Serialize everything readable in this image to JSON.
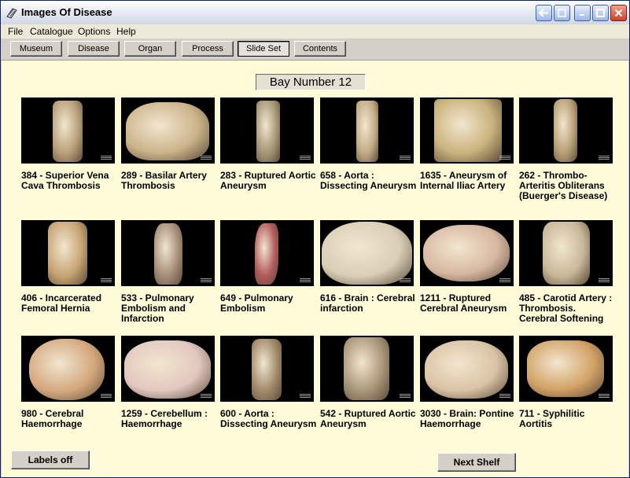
{
  "window": {
    "title": "Images Of Disease"
  },
  "menu": [
    "File",
    "Catalogue",
    "Options",
    "Help"
  ],
  "nav": {
    "buttons": [
      "Museum",
      "Disease",
      "Organ",
      "Process",
      "Slide Set",
      "Contents"
    ],
    "active": "Slide Set"
  },
  "bay_label": "Bay Number 12",
  "items": [
    {
      "caption": "384 - Superior Vena Cava Thrombosis",
      "specimen_color": "#b9a07a"
    },
    {
      "caption": "289 - Basilar Artery Thrombosis",
      "specimen_color": "#cbb48a"
    },
    {
      "caption": "283 - Ruptured Aortic Aneurysm",
      "specimen_color": "#a49776"
    },
    {
      "caption": "658 - Aorta : Dissecting Aneurysm",
      "specimen_color": "#c2ab85"
    },
    {
      "caption": "1635 - Aneurysm of Internal Iliac Artery",
      "specimen_color": "#c9b27c"
    },
    {
      "caption": "262 - Thrombo-Arteritis Obliterans (Buerger's Disease)",
      "specimen_color": "#b79f75"
    },
    {
      "caption": "406 - Incarcerated Femoral Hernia",
      "specimen_color": "#c7a473"
    },
    {
      "caption": "533 - Pulmonary Embolism and Infarction",
      "specimen_color": "#a58d78"
    },
    {
      "caption": "649 - Pulmonary Embolism",
      "specimen_color": "#b15a5a"
    },
    {
      "caption": "616 - Brain : Cerebral infarction",
      "specimen_color": "#d8cfb6"
    },
    {
      "caption": "1211 - Ruptured Cerebral Aneurysm",
      "specimen_color": "#d7b7a1"
    },
    {
      "caption": "485 - Carotid Artery : Thrombosis. Cerebral Softening",
      "specimen_color": "#c9b799"
    },
    {
      "caption": "980 - Cerebral Haemorrhage",
      "specimen_color": "#d3a77c"
    },
    {
      "caption": "1259 - Cerebellum : Haemorrhage",
      "specimen_color": "#e2c7c0"
    },
    {
      "caption": "600 - Aorta : Dissecting Aneurysm",
      "specimen_color": "#a0896a"
    },
    {
      "caption": "542 - Ruptured Aortic Aneurysm",
      "specimen_color": "#a99577"
    },
    {
      "caption": "3030 - Brain: Pontine Haemorrhage",
      "specimen_color": "#d9c3a4"
    },
    {
      "caption": "711 - Syphilitic Aortitis",
      "specimen_color": "#d3a266"
    }
  ],
  "buttons": {
    "labels_off": "Labels off",
    "next_shelf": "Next Shelf"
  },
  "colors": {
    "content_bg": "#fefbd9",
    "thumb_bg": "#000000"
  }
}
